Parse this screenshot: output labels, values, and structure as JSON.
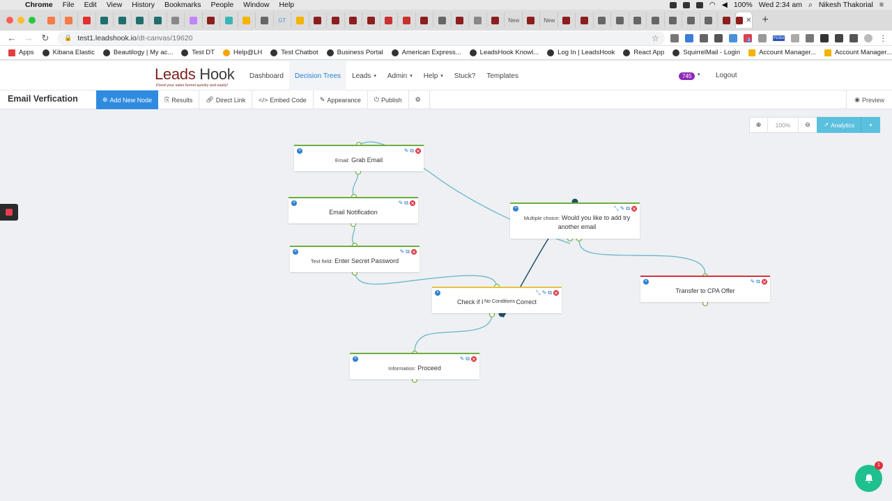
{
  "macos": {
    "app_name": "Chrome",
    "menu": [
      "File",
      "Edit",
      "View",
      "History",
      "Bookmarks",
      "People",
      "Window",
      "Help"
    ],
    "battery": "100%",
    "clock": "Wed 2:34 am",
    "user": "Nikesh Thakorial"
  },
  "browser": {
    "tab_favicons": [
      "#f47c48",
      "#f47c48",
      "#e03030",
      "#1f6f6f",
      "#1f6f6f",
      "#1f6f6f",
      "#1f6f6f",
      "#888",
      "#c084fc",
      "#8b1e1e",
      "#3ab5b5",
      "#f4b400",
      "#666",
      "#4a90d9",
      "#f4b400",
      "#8b1e1e",
      "#8b1e1e",
      "#8b1e1e",
      "#8b1e1e",
      "#c93030",
      "#c93030",
      "#8b1e1e",
      "#666",
      "#8b1e1e",
      "#888",
      "#8b1e1e",
      "#888",
      "#8b1e1e",
      "#8b1e1e",
      "#8b1e1e",
      "#8b1e1e",
      "#666",
      "#666",
      "#666",
      "#666",
      "#666",
      "#666",
      "#666",
      "#8b1e1e"
    ],
    "tab_labels": {
      "new1": "New",
      "new2": "New",
      "gt": "GT",
      "lh": "LH",
      "m": "m"
    },
    "url_host": "test1.leadshook.io",
    "url_path": "/dt-canvas/19620",
    "bookmarks": [
      "Apps",
      "Kibana Elastic",
      "Beautilogy | My ac...",
      "Test DT",
      "Help@LH",
      "Test Chatbot",
      "Business Portal",
      "American Express...",
      "LeadsHook Knowl...",
      "Log In | LeadsHook",
      "React App",
      "SquirrelMail - Login",
      "Account Manager...",
      "Account Manager..."
    ],
    "push_label": "PUSH",
    "ext_badge": "3"
  },
  "header": {
    "logo_leads": "Leads",
    "logo_hook": "Hook",
    "logo_tagline": "Flood your sales funnel quickly and easily!",
    "nav": [
      "Dashboard",
      "Decision Trees",
      "Leads",
      "Admin",
      "Help",
      "Stuck?",
      "Templates"
    ],
    "badge_count": "745",
    "logout": "Logout"
  },
  "toolbar": {
    "title": "Email Verfication",
    "buttons": [
      "Add New Node",
      "Results",
      "Direct Link",
      "Embed Code",
      "Appearance",
      "Publish"
    ],
    "preview": "Preview"
  },
  "canvas": {
    "zoom_level": "100%",
    "analytics": "Analytics",
    "no_conditions": "No Conditions",
    "notification_count": "1",
    "nodes": [
      {
        "type": "Email:",
        "label": "Grab Email"
      },
      {
        "type": "",
        "label": "Email Notification"
      },
      {
        "type": "Text field:",
        "label": "Enter Secret Password"
      },
      {
        "type": "Multiple choice:",
        "label": "Would you like to add try another email"
      },
      {
        "type": "",
        "label": "Check if F",
        "label_tail": "Correct"
      },
      {
        "type": "",
        "label": "Transfer to CPA Offer"
      },
      {
        "type": "Information:",
        "label": "Proceed"
      }
    ]
  },
  "colors": {
    "primary": "#2f8be0",
    "analytics": "#5bc0de",
    "green_border": "#6cae3e",
    "yellow_border": "#e8c23a",
    "red_border": "#d9303e",
    "connector": "#5fb3c9",
    "connector_dark": "#1f4e66",
    "anchor": "#7cb342",
    "bell": "#1fc08f",
    "badge": "#8e2bb8"
  }
}
